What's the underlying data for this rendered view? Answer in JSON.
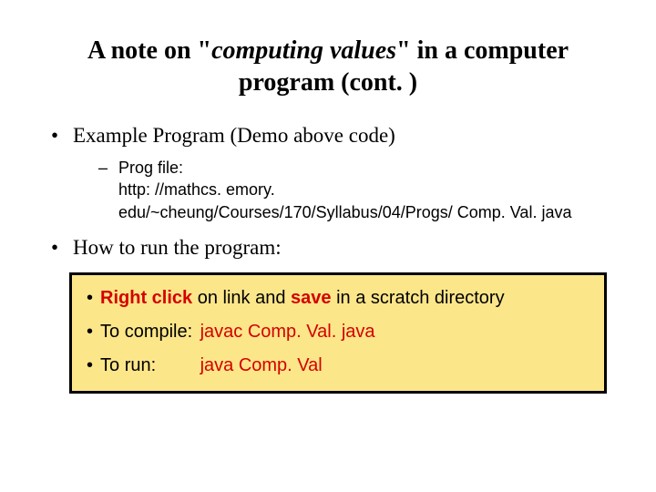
{
  "title": {
    "pre": "A note on \"",
    "ital": "computing values",
    "post": "\" in a computer program (cont. )"
  },
  "bullets": {
    "b1": "Example Program (Demo above code)",
    "b1_sub_label": "Prog file:",
    "b1_sub_link": "http: //mathcs. emory. edu/~cheung/Courses/170/Syllabus/04/Progs/ Comp. Val. java",
    "b2": "How to run the program:"
  },
  "box": {
    "line1_pre": "Right click",
    "line1_mid": " on link and ",
    "line1_save": "save",
    "line1_post": " in a scratch directory",
    "line2_label": "To compile:",
    "line2_cmd": "javac Comp. Val. java",
    "line3_label": "To run:",
    "line3_cmd": "java Comp. Val"
  }
}
